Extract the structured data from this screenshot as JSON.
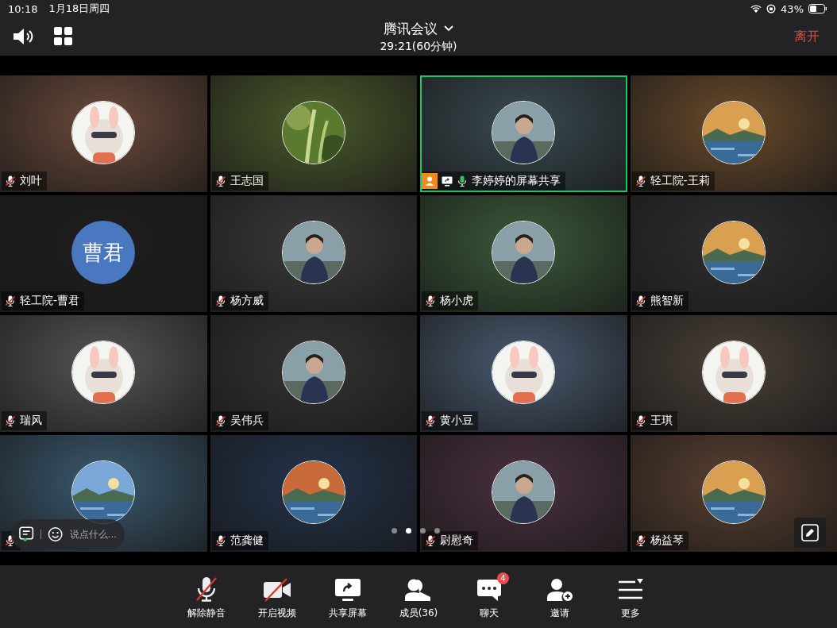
{
  "status_bar": {
    "time": "10:18",
    "date": "1月18日周四",
    "battery": "43%"
  },
  "header": {
    "title": "腾讯会议",
    "timer": "29:21(60分钟)",
    "leave": "离开"
  },
  "tiles": [
    {
      "name": "刘叶",
      "kind": "picture",
      "muted": true,
      "speaking": false,
      "sharing": false
    },
    {
      "name": "王志国",
      "kind": "picture",
      "muted": true,
      "speaking": false,
      "sharing": false
    },
    {
      "name": "李婷婷的屏幕共享",
      "kind": "picture",
      "muted": false,
      "speaking": true,
      "sharing": true
    },
    {
      "name": "轻工院-王莉",
      "kind": "picture",
      "muted": true,
      "speaking": false,
      "sharing": false
    },
    {
      "name": "轻工院-曹君",
      "kind": "initials",
      "initials": "曹君",
      "muted": true,
      "speaking": false,
      "sharing": false
    },
    {
      "name": "杨方威",
      "kind": "picture",
      "muted": true,
      "speaking": false,
      "sharing": false
    },
    {
      "name": "杨小虎",
      "kind": "picture",
      "muted": true,
      "speaking": false,
      "sharing": false
    },
    {
      "name": "熊智新",
      "kind": "picture",
      "muted": true,
      "speaking": false,
      "sharing": false
    },
    {
      "name": "瑞风",
      "kind": "picture",
      "muted": true,
      "speaking": false,
      "sharing": false
    },
    {
      "name": "吴伟兵",
      "kind": "picture",
      "muted": true,
      "speaking": false,
      "sharing": false
    },
    {
      "name": "黄小豆",
      "kind": "picture",
      "muted": true,
      "speaking": false,
      "sharing": false
    },
    {
      "name": "王琪",
      "kind": "picture",
      "muted": true,
      "speaking": false,
      "sharing": false
    },
    {
      "kind": "picture",
      "muted": true,
      "speaking": false,
      "sharing": false
    },
    {
      "name": "范龚健",
      "kind": "picture",
      "muted": true,
      "speaking": false,
      "sharing": false
    },
    {
      "name": "尉慰奇",
      "kind": "picture",
      "muted": true,
      "speaking": false,
      "sharing": false
    },
    {
      "name": "杨益琴",
      "kind": "picture",
      "muted": true,
      "speaking": false,
      "sharing": false
    }
  ],
  "chat_input": {
    "placeholder": "说点什么..."
  },
  "pages": [
    {
      "selected": false
    },
    {
      "selected": true
    },
    {
      "selected": false
    },
    {
      "selected": false
    }
  ],
  "toolbar": [
    {
      "kind": "mic",
      "label": "解除静音",
      "off": true
    },
    {
      "kind": "video",
      "label": "开启视频",
      "off": true
    },
    {
      "kind": "share",
      "label": "共享屏幕",
      "off": false
    },
    {
      "kind": "members",
      "label": "成员(36)",
      "off": false
    },
    {
      "kind": "chat",
      "label": "聊天",
      "off": false,
      "badge": "4"
    },
    {
      "kind": "invite",
      "label": "邀请",
      "off": false
    },
    {
      "kind": "more",
      "label": "更多",
      "off": false
    }
  ]
}
